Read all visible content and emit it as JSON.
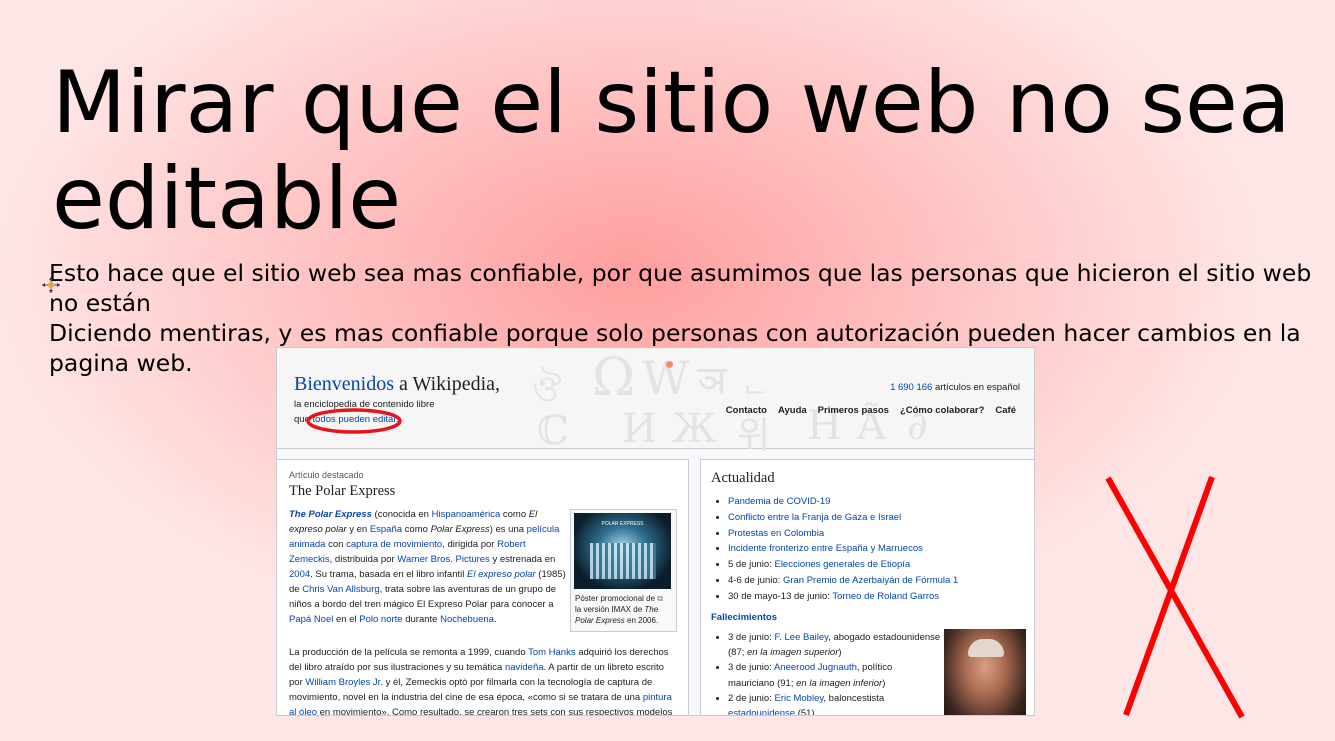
{
  "slide": {
    "title": "Mirar que el sitio web no sea editable",
    "body_line1": "Esto hace que el sitio web sea mas confiable, por que asumimos que las personas que hicieron el sitio web no están",
    "body_line2": "Diciendo mentiras, y es mas confiable porque solo personas con autorización pueden hacer cambios en la pagina web."
  },
  "wiki": {
    "welcome_prefix": "Bienvenidos",
    "welcome_suffix": " a Wikipedia,",
    "tagline1": "la enciclopedia de contenido libre",
    "tagline2_prefix": "que ",
    "tagline2_link": "todos pueden editar",
    "tagline2_suffix": ".",
    "article_count": "1 690 166",
    "article_count_suffix": " artículos en español",
    "nav": [
      "Contacto",
      "Ayuda",
      "Primeros pasos",
      "¿Cómo colaborar?",
      "Café"
    ],
    "featured": {
      "label": "Artículo destacado",
      "title": "The Polar Express",
      "poster_caption_1": "Póster promocional de",
      "poster_caption_2": "la versión IMAX de ",
      "poster_caption_italic": "The Polar Express",
      "poster_caption_3": " en 2006.",
      "poster_text": "POLAR EXPRESS"
    },
    "news": {
      "title": "Actualidad",
      "items": [
        {
          "pre": "",
          "link": "Pandemia de COVID-19"
        },
        {
          "pre": "",
          "link": "Conflicto entre la Franja de Gaza e Israel"
        },
        {
          "pre": "",
          "link": "Protestas en Colombia"
        },
        {
          "pre": "",
          "link": "Incidente fronterizo entre España y Marruecos"
        },
        {
          "pre": "5 de junio: ",
          "link": "Elecciones generales de Etiopía"
        },
        {
          "pre": "4-6 de junio: ",
          "link": "Gran Premio de Azerbaiyán de Fórmula 1"
        },
        {
          "pre": "30 de mayo-13 de junio: ",
          "link": "Torneo de Roland Garros"
        }
      ],
      "deaths_title": "Fallecimientos"
    }
  },
  "colors": {
    "wiki_link": "#0645ad",
    "red_mark": "#ff0000",
    "red_ellipse": "#e8141c"
  }
}
